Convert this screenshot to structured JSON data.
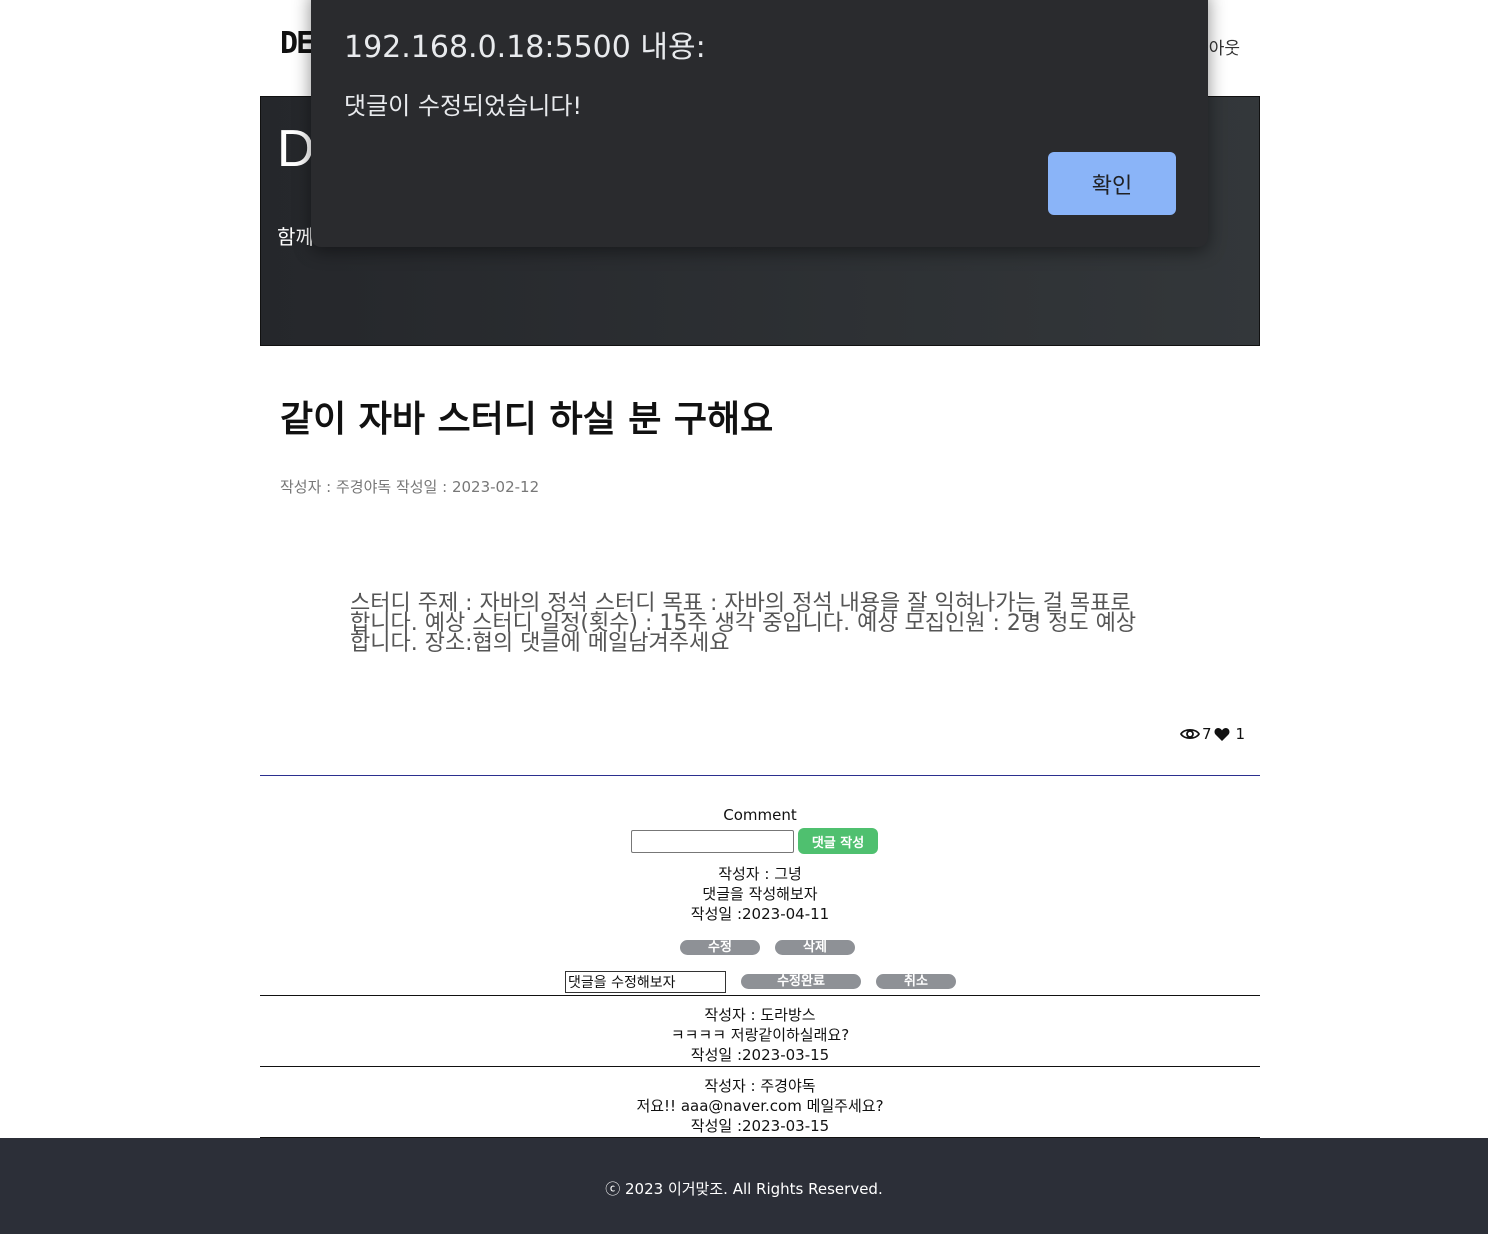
{
  "nav": {
    "logo": "DE",
    "logout": "아웃"
  },
  "hero": {
    "big": "D",
    "sub": "함께"
  },
  "post": {
    "title": "같이 자바 스터디 하실 분 구해요",
    "meta": "작성자 : 주경야독 작성일 : 2023-02-12",
    "body": "스터디 주제 : 자바의 정석 스터디 목표 : 자바의 정석 내용을 잘 익혀나가는 걸 목표로 합니다. 예상 스터디 일정(횟수) : 15주 생각 중입니다. 예상 모집인원 : 2명 정도 예상합니다. 장소:협의 댓글에 메일남겨주세요",
    "views": "7",
    "likes": "1"
  },
  "comments_section": {
    "heading": "Comment",
    "input_value": "",
    "submit_label": "댓글 작성",
    "items": [
      {
        "author": "작성자 : 그녕",
        "text": "댓글을 작성해보자",
        "date": "작성일 :2023-04-11"
      },
      {
        "author": "작성자 : 도라방스",
        "text": "ㅋㅋㅋㅋ 저랑같이하실래요?",
        "date": "작성일 :2023-03-15"
      },
      {
        "author": "작성자 : 주경야독",
        "text": "저요!! aaa@naver.com 메일주세요?",
        "date": "작성일 :2023-03-15"
      }
    ],
    "edit_label": "수정",
    "delete_label": "삭제",
    "edit_input_value": "댓글을 수정해보자",
    "save_label": "수정완료",
    "cancel_label": "취소"
  },
  "footer": {
    "text": "ⓒ 2023 이거맞조. All Rights Reserved."
  },
  "dialog": {
    "title": "192.168.0.18:5500 내용:",
    "message": "댓글이 수정되었습니다!",
    "ok_label": "확인"
  },
  "colors": {
    "accent_green": "#4fc06f",
    "dialog_button": "#8ab4f8",
    "footer_bg": "#2c2f38"
  }
}
